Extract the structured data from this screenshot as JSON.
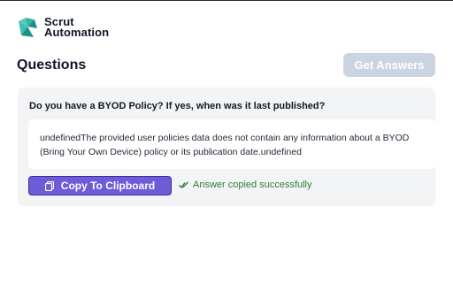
{
  "brand": {
    "line1": "Scrut",
    "line2": "Automation",
    "logo_icon": "scrut-logo-icon",
    "colors": {
      "teal": "#2fb7a6",
      "teal_dark": "#1f8f86"
    }
  },
  "header": {
    "title": "Questions",
    "get_answers_label": "Get Answers"
  },
  "qa": {
    "question": "Do you have a BYOD Policy? If yes, when was it last published?",
    "answer": "undefinedThe provided user policies data does not contain any information about a BYOD (Bring Your Own Device) policy or its publication date.undefined",
    "copy_label": "Copy To Clipboard",
    "copy_icon": "copy-icon",
    "status_text": "Answer copied successfully",
    "status_icon": "double-check-icon"
  },
  "colors": {
    "accent": "#6d5bd7",
    "disabled_button": "#cbd5e1",
    "success": "#2e7d32",
    "card_bg": "#f3f4f6"
  }
}
